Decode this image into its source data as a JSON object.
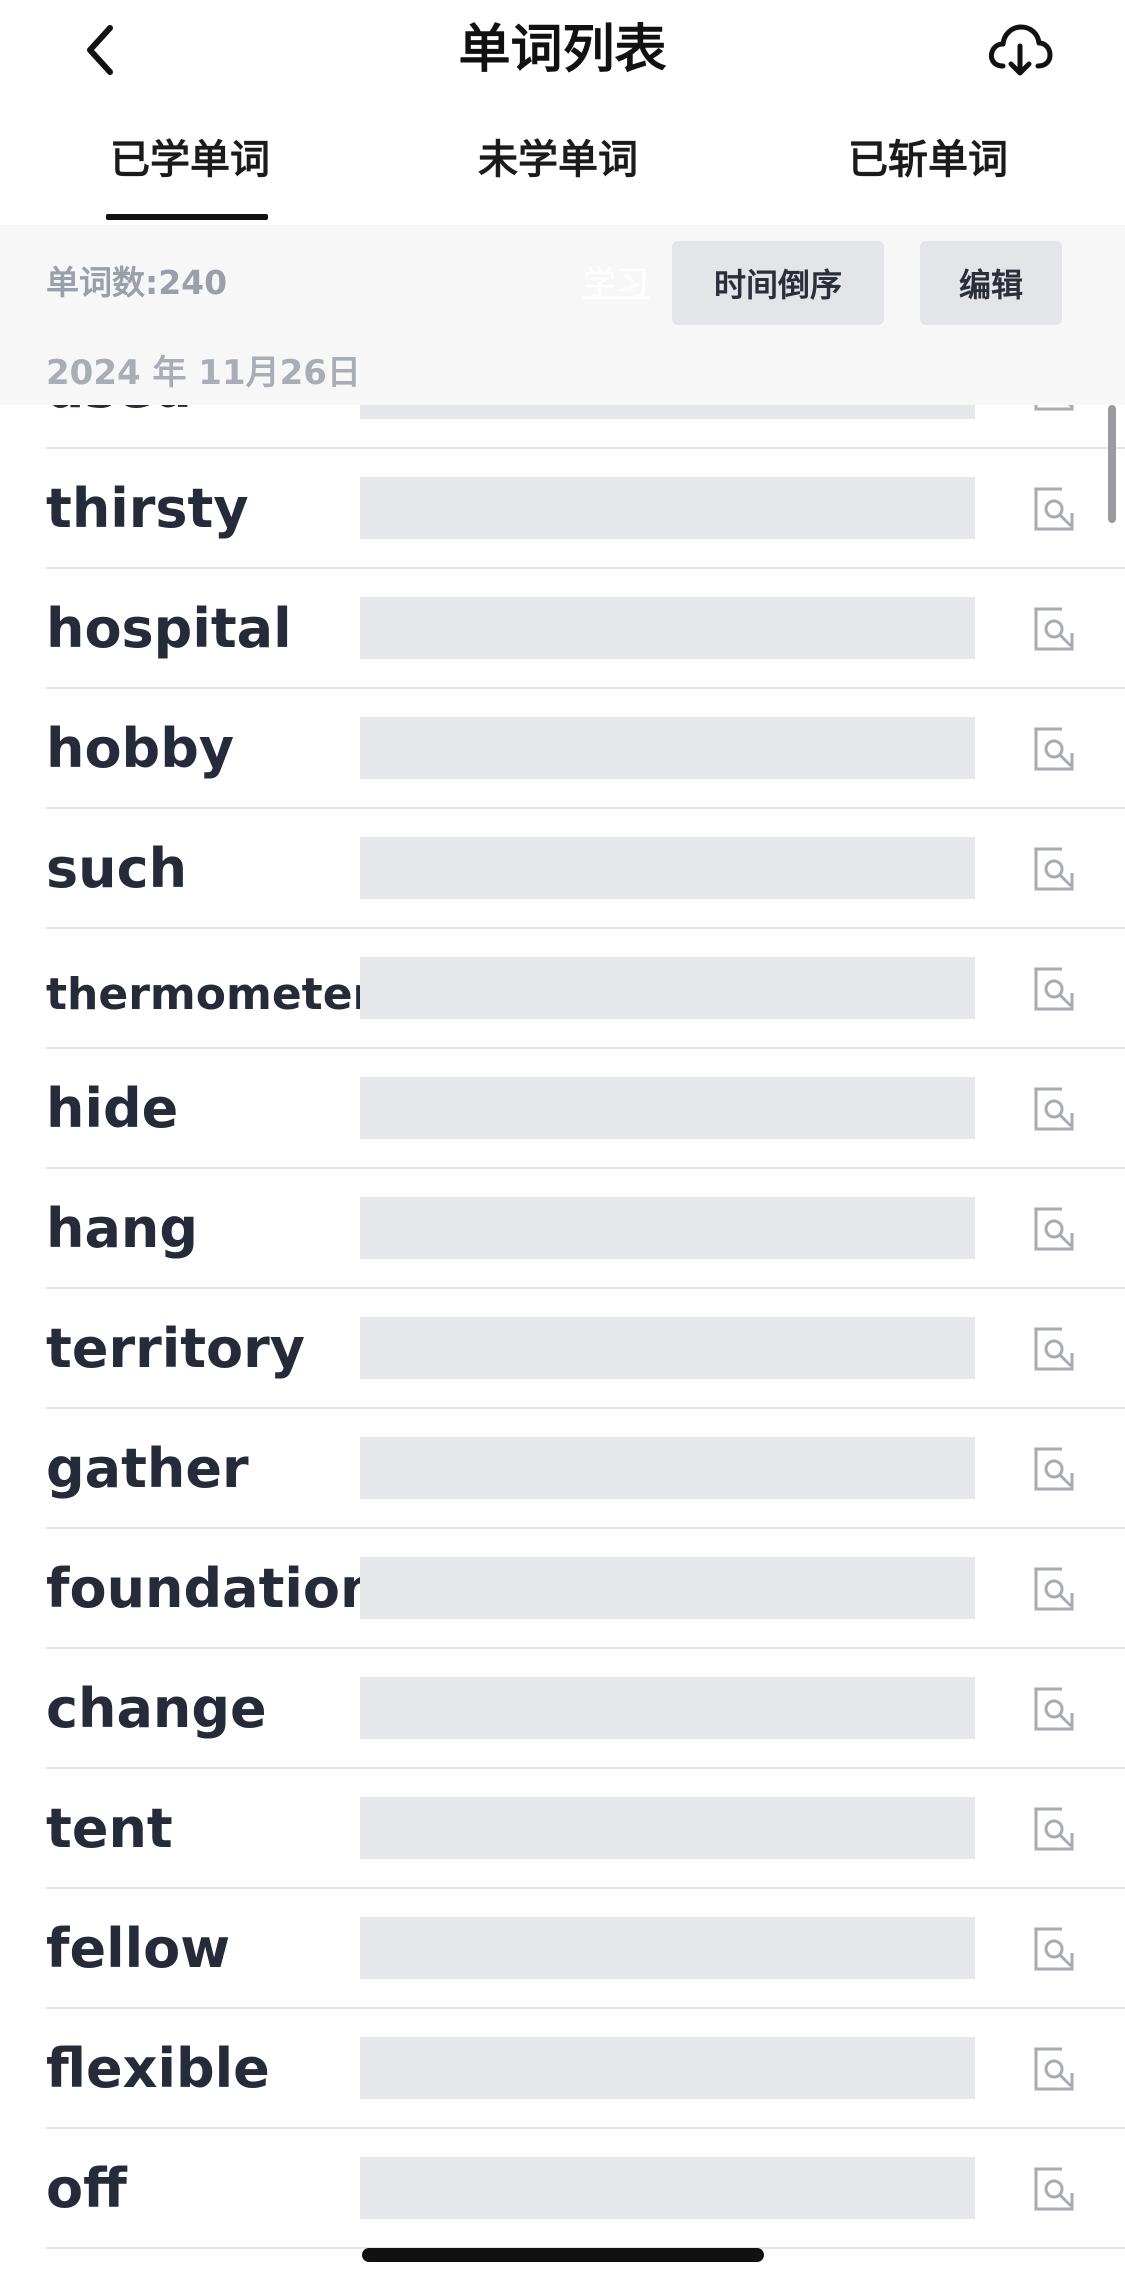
{
  "header": {
    "title": "单词列表",
    "back_icon": "chevron-left-icon",
    "download_icon": "cloud-download-icon"
  },
  "tabs": [
    {
      "label": "已学单词",
      "active": true
    },
    {
      "label": "未学单词",
      "active": false
    },
    {
      "label": "已斩单词",
      "active": false
    }
  ],
  "toolbar": {
    "count_label": "单词数:240",
    "study_link": "学习",
    "sort_button": "时间倒序",
    "edit_button": "编辑"
  },
  "section": {
    "date": "2024 年 11月26日"
  },
  "words": [
    "used",
    "thirsty",
    "hospital",
    "hobby",
    "such",
    "thermometer",
    "hide",
    "hang",
    "territory",
    "gather",
    "foundation",
    "change",
    "tent",
    "fellow",
    "flexible",
    "off"
  ],
  "colors": {
    "mask": "#e6e7eb",
    "text": "#262b3a",
    "toolbar_bg": "#f7f7f8"
  }
}
